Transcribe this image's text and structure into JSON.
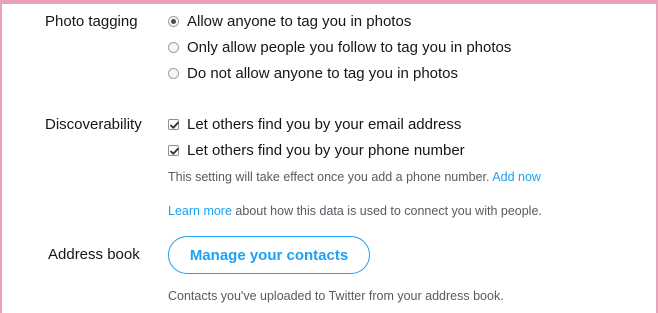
{
  "photo_tagging": {
    "label": "Photo tagging",
    "options": [
      {
        "label": "Allow anyone to tag you in photos",
        "selected": true
      },
      {
        "label": "Only allow people you follow to tag you in photos",
        "selected": false
      },
      {
        "label": "Do not allow anyone to tag you in photos",
        "selected": false
      }
    ]
  },
  "discoverability": {
    "label": "Discoverability",
    "options": [
      {
        "label": "Let others find you by your email address",
        "checked": true
      },
      {
        "label": "Let others find you by your phone number",
        "checked": true
      }
    ],
    "note_text": "This setting will take effect once you add a phone number.",
    "note_link": "Add now",
    "learn_more_link": "Learn more",
    "learn_more_text": "about how this data is used to connect you with people."
  },
  "address_book": {
    "label": "Address book",
    "button_label": "Manage your contacts",
    "description": "Contacts you've uploaded to Twitter from your address book."
  },
  "colors": {
    "accent": "#1da1f2",
    "frame": "#e8a3b8"
  }
}
